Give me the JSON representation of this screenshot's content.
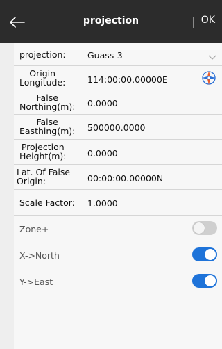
{
  "header": {
    "title": "projection",
    "ok_label": "OK"
  },
  "fields": {
    "projection": {
      "label": "projection:",
      "value": "Guass-3"
    },
    "origin_longitude": {
      "label_line1": "Origin",
      "label_line2": "Longitude:",
      "value": "114:00:00.00000E"
    },
    "false_northing": {
      "label_line1": "False",
      "label_line2": "Northing(m):",
      "value": "0.0000"
    },
    "false_easting": {
      "label_line1": "False",
      "label_line2": "Easthing(m):",
      "value": "500000.0000"
    },
    "projection_height": {
      "label_line1": "Projection",
      "label_line2": "Height(m):",
      "value": "0.0000"
    },
    "lat_false_origin": {
      "label_line1": "Lat. Of False",
      "label_line2": "Origin:",
      "value": "00:00:00.00000N"
    },
    "scale_factor": {
      "label": "Scale Factor:",
      "value": "1.0000"
    }
  },
  "toggles": {
    "zone_plus": {
      "label": "Zone+",
      "on": false
    },
    "x_north": {
      "label": "X->North",
      "on": true
    },
    "y_east": {
      "label": "Y->East",
      "on": true
    }
  },
  "colors": {
    "header_bg": "#2c2c2c",
    "switch_on": "#1e73d9",
    "switch_off": "#cfcfcf"
  }
}
